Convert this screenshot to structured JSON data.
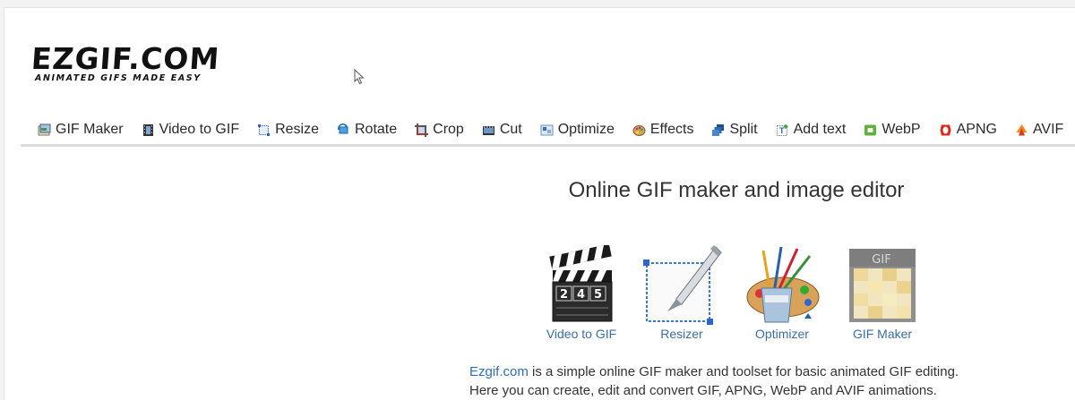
{
  "logo": {
    "title": "EZGIF.COM",
    "tagline": "ANIMATED GIFS MADE EASY"
  },
  "nav": {
    "items": [
      {
        "label": "GIF Maker",
        "icon": "gif-maker-icon"
      },
      {
        "label": "Video to GIF",
        "icon": "film-icon"
      },
      {
        "label": "Resize",
        "icon": "resize-icon"
      },
      {
        "label": "Rotate",
        "icon": "rotate-icon"
      },
      {
        "label": "Crop",
        "icon": "crop-icon"
      },
      {
        "label": "Cut",
        "icon": "cut-icon"
      },
      {
        "label": "Optimize",
        "icon": "optimize-icon"
      },
      {
        "label": "Effects",
        "icon": "palette-icon"
      },
      {
        "label": "Split",
        "icon": "split-icon"
      },
      {
        "label": "Add text",
        "icon": "add-text-icon"
      },
      {
        "label": "WebP",
        "icon": "webp-icon"
      },
      {
        "label": "APNG",
        "icon": "apng-icon"
      },
      {
        "label": "AVIF",
        "icon": "avif-icon"
      }
    ]
  },
  "hero": {
    "title": "Online GIF maker and image editor"
  },
  "tools": [
    {
      "label": "Video to GIF",
      "icon": "clapperboard-icon",
      "clap_text": "2 4 5"
    },
    {
      "label": "Resizer",
      "icon": "resizer-knife-icon"
    },
    {
      "label": "Optimizer",
      "icon": "paint-brushes-icon"
    },
    {
      "label": "GIF Maker",
      "icon": "gif-file-icon",
      "file_text": "GIF"
    }
  ],
  "intro": {
    "link": "Ezgif.com",
    "line1_rest": " is a simple online GIF maker and toolset for basic animated GIF editing.",
    "line2": "Here you can create, edit and convert GIF, APNG, WebP and AVIF animations."
  },
  "colors": {
    "link": "#2f6fb4",
    "tool_label": "#3a6ea5",
    "nav_border": "#dcdcdc"
  }
}
